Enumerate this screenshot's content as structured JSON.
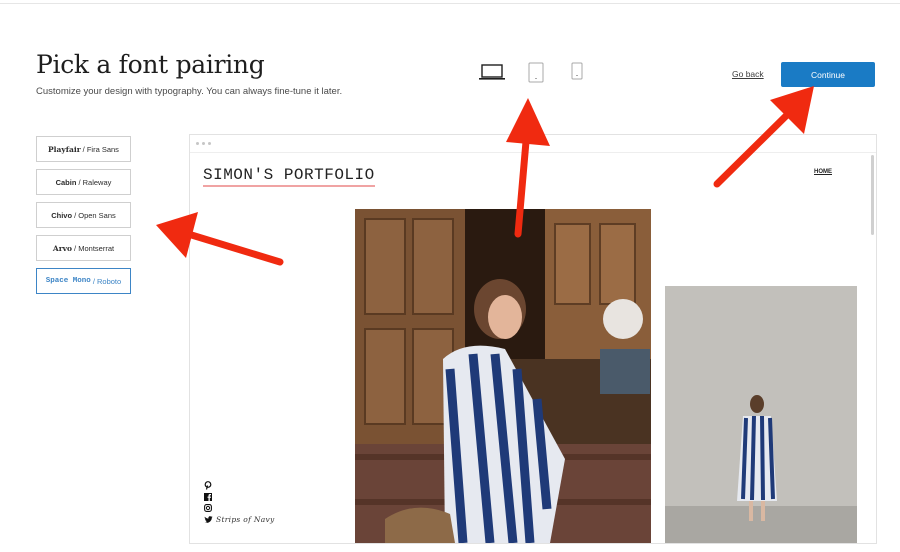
{
  "header": {
    "title": "Pick a font pairing",
    "subtitle": "Customize your design with typography. You can always fine-tune it later.",
    "go_back_label": "Go back",
    "continue_label": "Continue",
    "devices": [
      "desktop-icon",
      "tablet-icon",
      "phone-icon"
    ]
  },
  "font_pairings": [
    {
      "heading": "Playfair",
      "body": "Fira Sans",
      "selected": false
    },
    {
      "heading": "Cabin",
      "body": "Raleway",
      "selected": false
    },
    {
      "heading": "Chivo",
      "body": "Open Sans",
      "selected": false
    },
    {
      "heading": "Arvo",
      "body": "Montserrat",
      "selected": false
    },
    {
      "heading": "Space Mono",
      "body": "Roboto",
      "selected": true
    }
  ],
  "separator": "/",
  "preview": {
    "site_title": "SIMON'S PORTFOLIO",
    "nav_item": "HOME",
    "social_caption": "Strips of Navy",
    "social_icons": [
      "pinterest-icon",
      "facebook-icon",
      "instagram-icon",
      "twitter-icon"
    ]
  },
  "colors": {
    "accent": "#1a7bc5",
    "arrow": "#f02a10",
    "selected_border": "#3d85c6",
    "title_underline": "#f0a3a3"
  }
}
